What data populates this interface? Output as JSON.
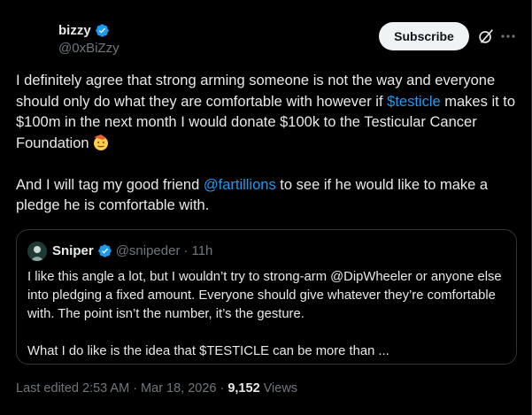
{
  "author": {
    "display_name": "bizzy",
    "handle": "@0xBiZzy"
  },
  "header": {
    "subscribe_label": "Subscribe",
    "grok_icon": "grok-icon",
    "more_icon": "more-icon"
  },
  "tweet": {
    "p1_before": "I definitely agree that strong arming someone is not the way and everyone should only do what they are comfortable with however if ",
    "cashtag": "$testicle",
    "p1_after": " makes it to $100m in the next month I would donate $100k to the Testicular Cancer Foundation",
    "emoji": "salute-face-emoji",
    "p2_before": "And I will tag my good friend ",
    "mention": "@fartillions",
    "p2_after": " to see if he would like to make a pledge he is comfortable with."
  },
  "quote": {
    "display_name": "Sniper",
    "handle": "@snipeder",
    "separator": "·",
    "time": "11h",
    "paragraph1": "I like this angle a lot, but I wouldn’t try to strong-arm @DipWheeler or anyone else into pledging a fixed amount. Everyone should give whatever they’re comfortable with. The point isn’t the number, it’s the gesture.",
    "paragraph2": "What I do like is the idea that $TESTICLE can be more than ..."
  },
  "meta": {
    "edited_time": "Last edited 2:53 AM · Mar 18, 2026",
    "separator": "·",
    "views_count": "9,152",
    "views_label": "Views"
  },
  "colors": {
    "background": "#000000",
    "text": "#e7e9ea",
    "muted": "#71767b",
    "link": "#1d9bf0",
    "border": "#2f3336",
    "verified": "#1d9bf0"
  }
}
